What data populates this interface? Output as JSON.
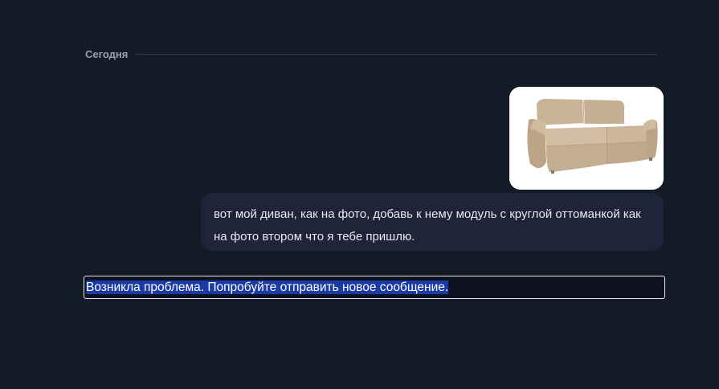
{
  "chat": {
    "date_divider": "Сегодня",
    "user_message": {
      "attachment": {
        "kind": "image",
        "subject": "sofa",
        "colors": {
          "background": "#ffffff",
          "upholstery": "#cdb79b"
        }
      },
      "text": "вот мой диван, как на фото, добавь к нему модуль с круглой оттоманкой как на фото втором что я тебе пришлю."
    },
    "error_message": "Возникла проблема. Попробуйте отправить новое сообщение."
  },
  "colors": {
    "background": "#151a27",
    "bubble": "#1f2438",
    "selection_highlight": "#1a3aa6",
    "divider_text": "#9aa0ad"
  }
}
